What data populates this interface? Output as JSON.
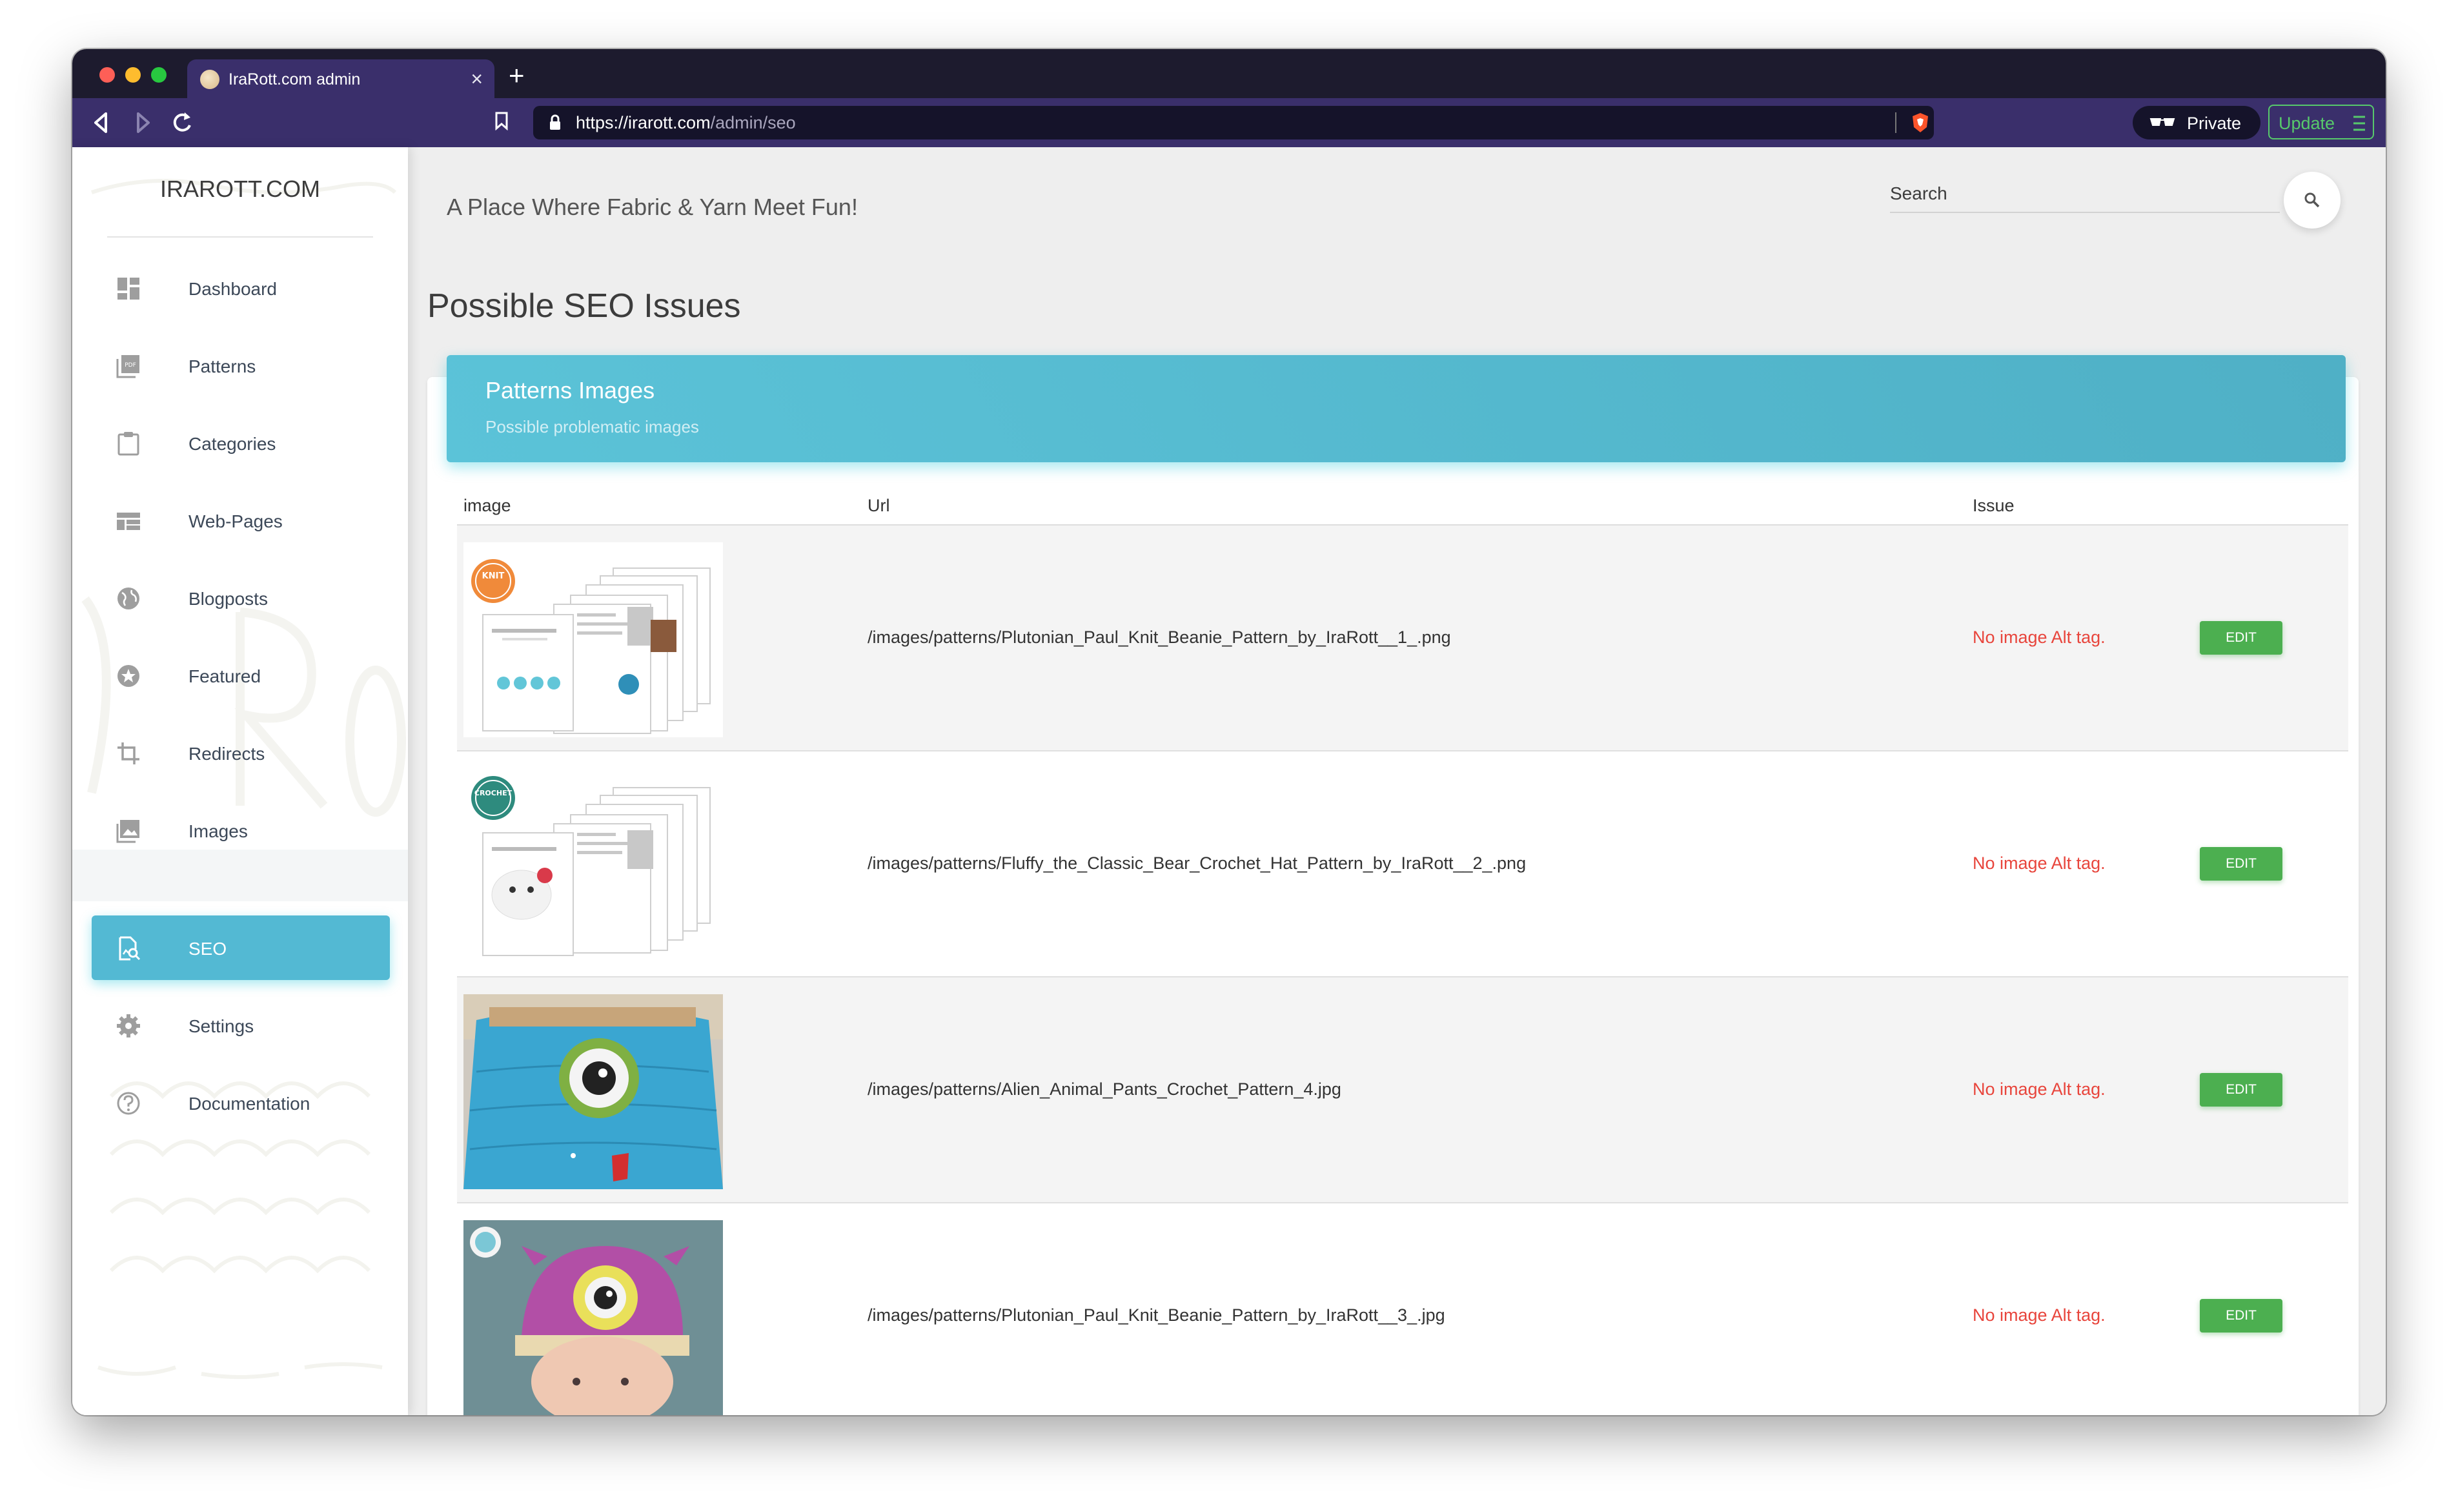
{
  "browser": {
    "tab_title": "IraRott.com admin",
    "tab_close": "×",
    "new_tab": "+",
    "url_host": "https://irarott.com",
    "url_path": "/admin/seo",
    "private_label": "Private",
    "update_label": "Update"
  },
  "sidebar": {
    "logo": "IRAROTT.COM",
    "items": [
      {
        "label": "Dashboard",
        "icon": "dashboard-icon"
      },
      {
        "label": "Patterns",
        "icon": "pdf-icon"
      },
      {
        "label": "Categories",
        "icon": "clipboard-icon"
      },
      {
        "label": "Web-Pages",
        "icon": "web-icon"
      },
      {
        "label": "Blogposts",
        "icon": "globe-icon"
      },
      {
        "label": "Featured",
        "icon": "star-icon"
      },
      {
        "label": "Redirects",
        "icon": "crop-icon"
      },
      {
        "label": "Images",
        "icon": "image-icon"
      },
      {
        "label": "SEO",
        "icon": "seo-icon",
        "active": true
      },
      {
        "label": "Settings",
        "icon": "gear-icon"
      },
      {
        "label": "Documentation",
        "icon": "help-icon"
      }
    ]
  },
  "header": {
    "tagline": "A Place Where Fabric & Yarn Meet Fun!",
    "search_label": "Search"
  },
  "main": {
    "page_title": "Possible SEO Issues",
    "card": {
      "title": "Patterns Images",
      "subtitle": "Possible problematic images"
    },
    "table": {
      "columns": [
        "image",
        "Url",
        "Issue"
      ],
      "rows": [
        {
          "url": "/images/patterns/Plutonian_Paul_Knit_Beanie_Pattern_by_IraRott__1_.png",
          "issue": "No image Alt tag.",
          "action": "EDIT",
          "thumb": "knit-pattern-pages"
        },
        {
          "url": "/images/patterns/Fluffy_the_Classic_Bear_Crochet_Hat_Pattern_by_IraRott__2_.png",
          "issue": "No image Alt tag.",
          "action": "EDIT",
          "thumb": "crochet-pattern-pages"
        },
        {
          "url": "/images/patterns/Alien_Animal_Pants_Crochet_Pattern_4.jpg",
          "issue": "No image Alt tag.",
          "action": "EDIT",
          "thumb": "blue-alien-pants-photo"
        },
        {
          "url": "/images/patterns/Plutonian_Paul_Knit_Beanie_Pattern_by_IraRott__3_.jpg",
          "issue": "No image Alt tag.",
          "action": "EDIT",
          "thumb": "purple-alien-beanie-photo"
        }
      ]
    }
  },
  "colors": {
    "accent": "#53b9d3",
    "issue": "#e8453c",
    "edit": "#4caf50",
    "browser_dark": "#1d1b2e",
    "browser_toolbar": "#3a2f6b"
  }
}
